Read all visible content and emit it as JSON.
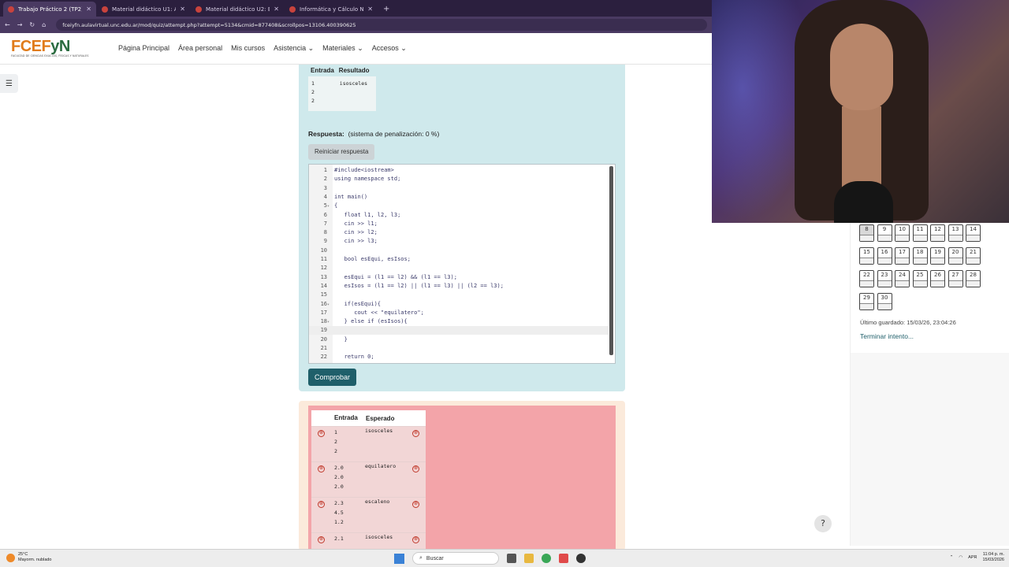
{
  "browser": {
    "tabs": [
      {
        "title": "Trabajo Práctico 2 (TP2) | NVA",
        "active": true
      },
      {
        "title": "Material didáctico U1: Almacen",
        "active": false
      },
      {
        "title": "Material didáctico U2: Estructu",
        "active": false
      },
      {
        "title": "Informática y Cálculo Numéric",
        "active": false
      }
    ],
    "new_tab": "+",
    "url": "fceiyfn.aulavirtual.unc.edu.ar/mod/quiz/attempt.php?attempt=5134&cmid=877408&scrollpos=13106.400390625"
  },
  "site": {
    "logo_text_a": "FCEF",
    "logo_text_b": "yN",
    "logo_sub": "FACULTAD DE CIENCIAS EXACTAS, FÍSICAS Y NATURALES",
    "nav": [
      "Página Principal",
      "Área personal",
      "Mis cursos",
      "Asistencia ⌄",
      "Materiales ⌄",
      "Accesos ⌄"
    ]
  },
  "question": {
    "example_headers": [
      "Entrada",
      "Resultado"
    ],
    "example_input": "1\n2\n2",
    "example_result": "isosceles",
    "answer_label": "Respuesta:",
    "penalty_text": "(sistema de penalización: 0 %)",
    "reset_label": "Reiniciar respuesta",
    "check_label": "Comprobar",
    "code_lines": [
      {
        "n": "1",
        "fold": "",
        "text": "#include<iostream>"
      },
      {
        "n": "2",
        "fold": "",
        "text": "using namespace std;"
      },
      {
        "n": "3",
        "fold": "",
        "text": ""
      },
      {
        "n": "4",
        "fold": "",
        "text": "int main()"
      },
      {
        "n": "5",
        "fold": "▾",
        "text": "{"
      },
      {
        "n": "6",
        "fold": "",
        "text": "   float l1, l2, l3;"
      },
      {
        "n": "7",
        "fold": "",
        "text": "   cin >> l1;"
      },
      {
        "n": "8",
        "fold": "",
        "text": "   cin >> l2;"
      },
      {
        "n": "9",
        "fold": "",
        "text": "   cin >> l3;"
      },
      {
        "n": "10",
        "fold": "",
        "text": ""
      },
      {
        "n": "11",
        "fold": "",
        "text": "   bool esEqui, esIsos;"
      },
      {
        "n": "12",
        "fold": "",
        "text": ""
      },
      {
        "n": "13",
        "fold": "",
        "text": "   esEqui = (l1 == l2) && (l1 == l3);"
      },
      {
        "n": "14",
        "fold": "",
        "text": "   esIsos = (l1 == l2) || (l1 == l3) || (l2 == l3);"
      },
      {
        "n": "15",
        "fold": "",
        "text": ""
      },
      {
        "n": "16",
        "fold": "▾",
        "text": "   if(esEqui){"
      },
      {
        "n": "17",
        "fold": "",
        "text": "      cout << \"equilatero\";"
      },
      {
        "n": "18",
        "fold": "▾",
        "text": "   } else if (esIsos){"
      },
      {
        "n": "19",
        "fold": "",
        "text": ""
      },
      {
        "n": "20",
        "fold": "",
        "text": "   }"
      },
      {
        "n": "21",
        "fold": "",
        "text": ""
      },
      {
        "n": "22",
        "fold": "",
        "text": "   return 0;"
      }
    ]
  },
  "results": {
    "headers": [
      "",
      "Entrada",
      "Esperado",
      ""
    ],
    "rows": [
      {
        "input": "1\n2\n2",
        "expected": "isosceles"
      },
      {
        "input": "2.0\n2.0\n2.0",
        "expected": "equilatero"
      },
      {
        "input": "2.3\n4.5\n1.2",
        "expected": "escaleno"
      },
      {
        "input": "2.1",
        "expected": "isosceles"
      }
    ],
    "fail_icon": "⊗"
  },
  "quiz_nav": {
    "rows": [
      [
        "8",
        "9",
        "10",
        "11",
        "12",
        "13",
        "14"
      ],
      [
        "15",
        "16",
        "17",
        "18",
        "19",
        "20",
        "21"
      ],
      [
        "22",
        "23",
        "24",
        "25",
        "26",
        "27",
        "28"
      ],
      [
        "29",
        "30"
      ]
    ],
    "current": "8",
    "last_saved": "Último guardado: 15/03/26, 23:04:26",
    "finish_label": "Terminar intento..."
  },
  "help_label": "?",
  "taskbar": {
    "temp": "25°C",
    "weather": "Mayorm. nublado",
    "search": "Buscar",
    "lang": "APR",
    "time": "11:04 p. m.",
    "date": "15/03/2026"
  },
  "colors": {
    "question_bg": "#cfe9ec",
    "check_button": "#1f5f6a",
    "result_fail_bg": "#f3a4a9"
  }
}
